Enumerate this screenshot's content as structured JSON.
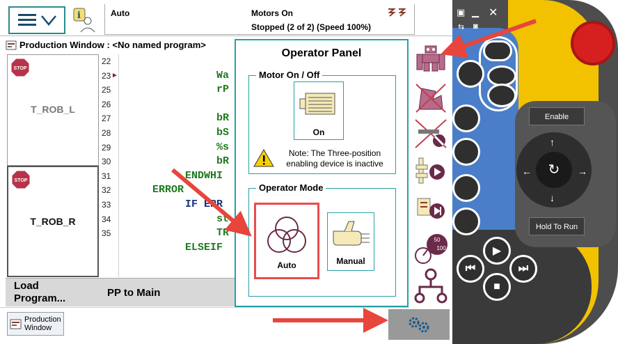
{
  "status": {
    "mode": "Auto",
    "motors": "Motors On",
    "state": "Stopped (2 of 2) (Speed 100%)"
  },
  "production_window": {
    "title": "Production Window : <No named program>"
  },
  "tasks": [
    {
      "label": "T_ROB_L"
    },
    {
      "label": "T_ROB_R"
    }
  ],
  "code": {
    "line_numbers": [
      "22",
      "23",
      "25",
      "26",
      "27",
      "28",
      "29",
      "30",
      "31",
      "32",
      "33",
      "34",
      "35"
    ],
    "lines": [
      "",
      "Wa",
      "rP",
      "",
      "bR",
      "bS",
      "%s",
      "bR",
      "ENDWHI",
      "ERROR",
      "IF ERR",
      "st",
      "TR",
      "ELSEIF"
    ]
  },
  "bottom_bar": {
    "load_label_1": "Load",
    "load_label_2": "Program...",
    "pp_label": "PP to Main"
  },
  "taskbar": {
    "prod_window_1": "Production",
    "prod_window_2": "Window"
  },
  "operator_panel": {
    "title": "Operator Panel",
    "motor_group_title": "Motor On / Off",
    "motor_on_label": "On",
    "note_1": "Note: The Three-position",
    "note_2": "enabling device is inactive",
    "mode_group_title": "Operator Mode",
    "auto_label": "Auto",
    "manual_label": "Manual"
  },
  "pendant": {
    "enable_label": "Enable",
    "hold_label": "Hold To Run"
  },
  "colors": {
    "teal": "#26a0a6",
    "highlight_red": "#e84c4c",
    "arrow_red": "#e8453c",
    "code_green": "#1f7a1f",
    "code_blue": "#13317a"
  },
  "icons": [
    "menu-icon",
    "info-icon",
    "motors-icon",
    "stop-sign-icon",
    "robot-icon",
    "settings-icon",
    "warning-icon",
    "motor-icon",
    "auto-icon",
    "manual-icon"
  ]
}
